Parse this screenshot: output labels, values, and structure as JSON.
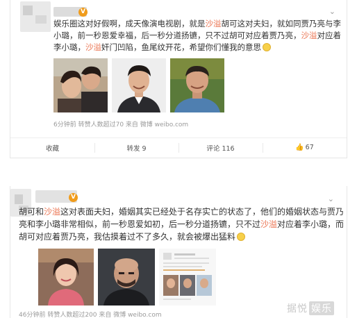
{
  "post1": {
    "verified_badge": "V",
    "text_parts": [
      {
        "t": "娱乐圈这对好假啊，成天像演电视剧，就是",
        "hl": false
      },
      {
        "t": "沙溢",
        "hl": true
      },
      {
        "t": "胡可这对夫妇，就如同贾乃亮与李小璐，前一秒恩爱幸福，后一秒分道扬镳，只不过胡可对应着贾乃亮，",
        "hl": false
      },
      {
        "t": "沙溢",
        "hl": true
      },
      {
        "t": "对应着李小璐，",
        "hl": false
      },
      {
        "t": "沙溢",
        "hl": true
      },
      {
        "t": "奸门凹陷，鱼尾纹开花，希望你们懂我的意思",
        "hl": false
      }
    ],
    "meta": "6分钟前 转赞人数超过70 来自 微博 weibo.com",
    "actions": {
      "collect": "收藏",
      "repost": "转发 9",
      "comment": "评论 116",
      "like": "67"
    }
  },
  "post2": {
    "verified_badge": "V",
    "text_parts": [
      {
        "t": "胡可和",
        "hl": false
      },
      {
        "t": "沙溢",
        "hl": true
      },
      {
        "t": "这对表面夫妇，婚姻其实已经处于名存实亡的状态了，他们的婚姻状态与贾乃亮和李小璐非常相似，前一秒恩爱如初，后一秒分道扬镳，只不过",
        "hl": false
      },
      {
        "t": "沙溢",
        "hl": true
      },
      {
        "t": "对应着李小璐，而胡可对应着贾乃亮，我估摸着过不了多久，就会被爆出猛料",
        "hl": false
      }
    ],
    "meta": "46分钟前 转赞人数超过200 来自 微博 weibo.com"
  },
  "watermark": {
    "part1": "据悦",
    "part2": "娱乐"
  },
  "colors": {
    "highlight": "#eb7350",
    "badge": "#f09c1c"
  }
}
